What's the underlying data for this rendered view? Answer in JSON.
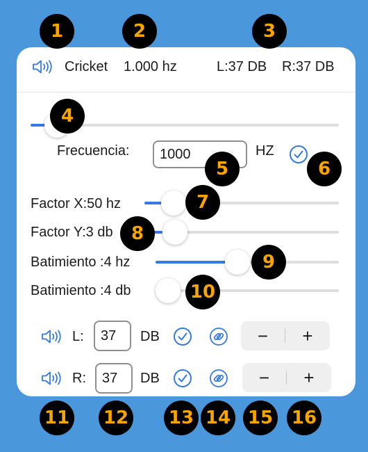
{
  "header": {
    "speaker_icon": "speaker-wave-icon",
    "sound_name": "Cricket",
    "frequency_display": "1.000 hz",
    "left_level": "L:37 DB",
    "right_level": "R:37 DB"
  },
  "frequency": {
    "slider_level": 0.04,
    "label": "Frecuencia:",
    "value": "1000",
    "unit": "HZ",
    "check_icon": "checkmark-circle-icon"
  },
  "sliders": [
    {
      "label": "Factor X:50 hz",
      "level": 0.17
    },
    {
      "label": "Factor Y:3 db",
      "level": 0.07
    },
    {
      "label": "Batimiento :4 hz",
      "level": 0.45
    },
    {
      "label": "Batimiento :4 db",
      "level": 0.0
    }
  ],
  "channels": [
    {
      "speaker_icon": "speaker-wave-icon",
      "label": "L:",
      "value": "37",
      "unit": "DB",
      "check_icon": "checkmark-circle-icon",
      "link_icon": "link-circle-icon",
      "minus": "−",
      "plus": "+"
    },
    {
      "speaker_icon": "speaker-wave-icon",
      "label": "R:",
      "value": "37",
      "unit": "DB",
      "check_icon": "checkmark-circle-icon",
      "link_icon": "link-circle-icon",
      "minus": "−",
      "plus": "+"
    }
  ],
  "annotations": [
    "1",
    "2",
    "3",
    "4",
    "5",
    "6",
    "7",
    "8",
    "9",
    "10",
    "11",
    "12",
    "13",
    "14",
    "15",
    "16"
  ],
  "colors": {
    "background": "#4a97dc",
    "accent": "#3479e6",
    "badge_bg": "#000000",
    "badge_text": "#f7a400"
  }
}
